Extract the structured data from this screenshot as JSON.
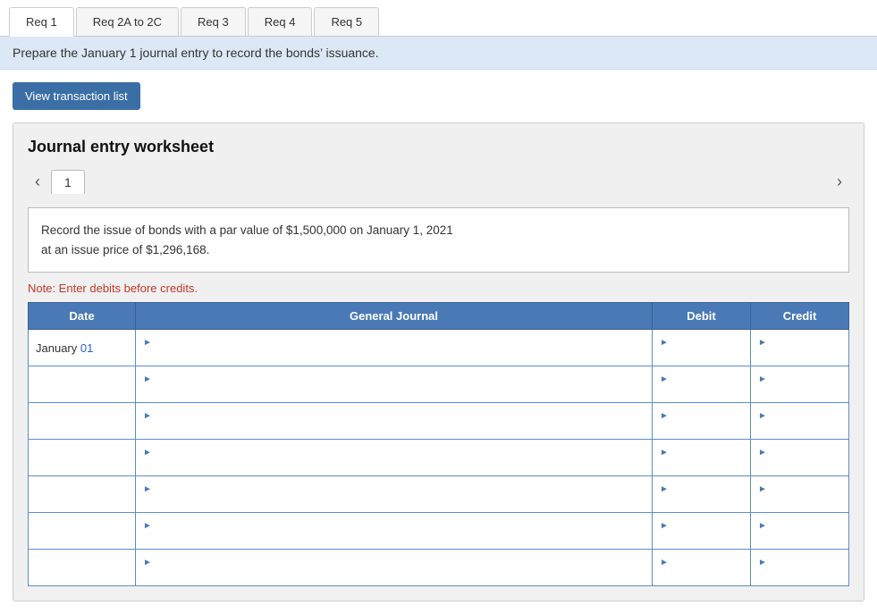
{
  "tabs": [
    {
      "id": "req1",
      "label": "Req 1",
      "active": true
    },
    {
      "id": "req2a2c",
      "label": "Req 2A to 2C",
      "active": false
    },
    {
      "id": "req3",
      "label": "Req 3",
      "active": false
    },
    {
      "id": "req4",
      "label": "Req 4",
      "active": false
    },
    {
      "id": "req5",
      "label": "Req 5",
      "active": false
    }
  ],
  "info_bar": {
    "text": "Prepare the January 1 journal entry to record the bonds’ issuance."
  },
  "view_transaction_btn": "View transaction list",
  "worksheet": {
    "title": "Journal entry worksheet",
    "current_page": "1",
    "description": "Record the issue of bonds with a par value of $1,500,000 on January 1, 2021\nat an issue price of $1,296,168.",
    "note": "Note: Enter debits before credits.",
    "table": {
      "headers": [
        "Date",
        "General Journal",
        "Debit",
        "Credit"
      ],
      "rows": [
        {
          "date": "January 01",
          "journal": "",
          "debit": "",
          "credit": ""
        },
        {
          "date": "",
          "journal": "",
          "debit": "",
          "credit": ""
        },
        {
          "date": "",
          "journal": "",
          "debit": "",
          "credit": ""
        },
        {
          "date": "",
          "journal": "",
          "debit": "",
          "credit": ""
        },
        {
          "date": "",
          "journal": "",
          "debit": "",
          "credit": ""
        },
        {
          "date": "",
          "journal": "",
          "debit": "",
          "credit": ""
        },
        {
          "date": "",
          "journal": "",
          "debit": "",
          "credit": ""
        }
      ]
    }
  },
  "colors": {
    "tab_active_bg": "#ffffff",
    "tab_inactive_bg": "#f5f5f5",
    "info_bar_bg": "#dce8f5",
    "btn_bg": "#3a6ea5",
    "table_header_bg": "#4a7ab5",
    "table_border": "#5b8fc9",
    "note_color": "#c0392b",
    "date_blue": "#2563c0"
  }
}
